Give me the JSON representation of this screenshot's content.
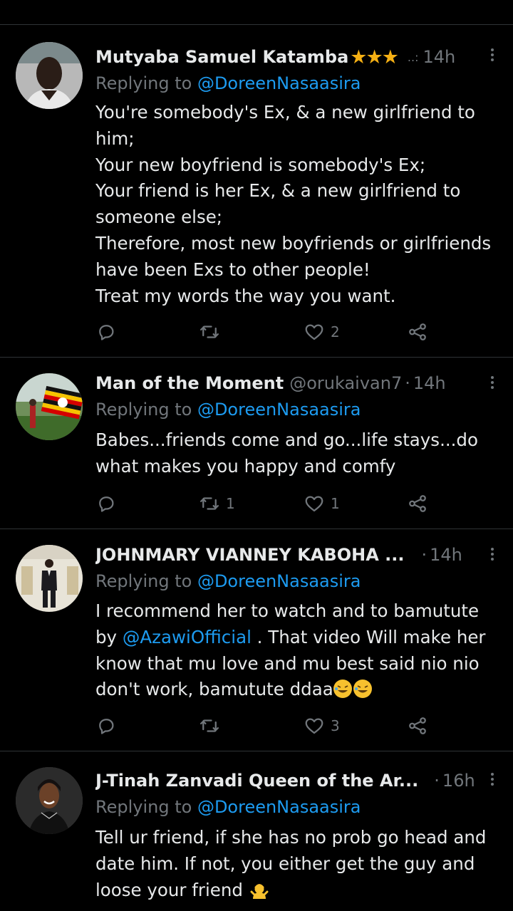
{
  "tweets": [
    {
      "name": "Mutyaba Samuel Katamba",
      "stars": "★★★",
      "handle": "..:",
      "time": "14h",
      "reply_prefix": "Replying to ",
      "reply_to": "@DoreenNasaasira",
      "lines": [
        "You're somebody's Ex, & a new girlfriend to",
        "him;",
        "Your new boyfriend is somebody's Ex;",
        "Your friend is her Ex, & a new girlfriend to",
        "someone else;",
        "Therefore, most new boyfriends or girlfriends",
        "have been Exs to other people!",
        "Treat my words the way you want."
      ],
      "replies": "",
      "retweets": "",
      "likes": "2",
      "avatar_icon": "person-avatar"
    },
    {
      "name": "Man of the Moment",
      "handle": "@orukaivan7",
      "time": "14h",
      "reply_prefix": "Replying to ",
      "reply_to": "@DoreenNasaasira",
      "lines": [
        "Babes...friends come and go...life stays...do",
        "what makes you happy and comfy"
      ],
      "replies": "",
      "retweets": "1",
      "likes": "1",
      "avatar_icon": "uganda-flag-avatar"
    },
    {
      "name": "JOHNMARY VIANNEY KABOHA ...",
      "handle": "",
      "time": "14h",
      "reply_prefix": "Replying to ",
      "reply_to": "@DoreenNasaasira",
      "line1": "I recommend her to watch and to bamutute",
      "line2_prefix": "by ",
      "line2_mention": "@AzawiOfficial",
      "line2_suffix": " . That video Will make her",
      "line3": "know that mu love and mu best said nio nio",
      "line4": "don't work, bamutute ddaa",
      "replies": "",
      "retweets": "",
      "likes": "3",
      "avatar_icon": "suited-man-avatar",
      "emoji_icon": "rolling-laughing-emoji"
    },
    {
      "name": "J-Tinah Zanvadi Queen of the Ar...",
      "handle": "",
      "time": "16h",
      "reply_prefix": "Replying to ",
      "reply_to": "@DoreenNasaasira",
      "lines": [
        "Tell ur friend, if she has no prob go head and",
        "date him. If not, you either get the guy and",
        "loose your friend"
      ],
      "avatar_icon": "woman-avatar",
      "emoji_icon": "shrugging-person-emoji"
    }
  ],
  "colors": {
    "background": "#000000",
    "text": "#e7e9ea",
    "muted": "#71767b",
    "link": "#1d9bf0",
    "divider": "#2f3336",
    "stars": "#f5b014"
  }
}
